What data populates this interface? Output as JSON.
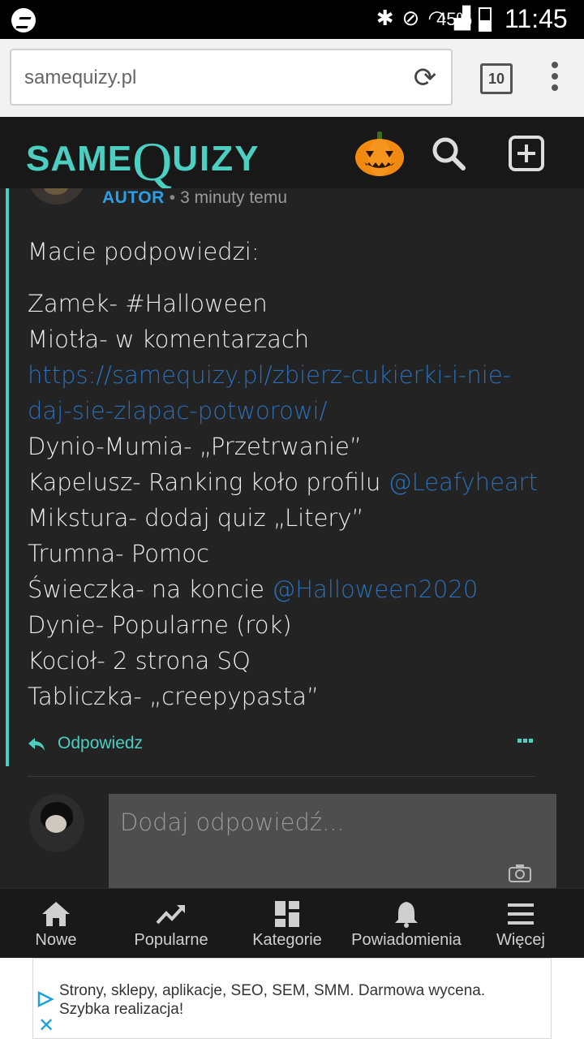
{
  "status_bar": {
    "battery": "45%",
    "time": "11:45"
  },
  "browser": {
    "url": "samequizy.pl",
    "tab_count": "10"
  },
  "site_header": {
    "logo_same": "SAME",
    "logo_q": "Q",
    "logo_uizy": "UIZY"
  },
  "comment": {
    "author_badge": "AUTOR",
    "separator": "•",
    "time": "3 minuty temu",
    "intro": "Macie podpowiedzi:",
    "lines": [
      {
        "text": "Zamek- #Halloween"
      },
      {
        "text": "Miotła- w komentarzach"
      },
      {
        "link": "https://samequizy.pl/zbierz-cukierki-i-nie-"
      },
      {
        "link": "daj-sie-zlapac-potworowi/"
      },
      {
        "text": "Dynio-Mumia- „Przetrwanie”"
      },
      {
        "text": "Kapelusz- Ranking koło profilu ",
        "mention": "@Leafyheart"
      },
      {
        "text": "Mikstura- dodaj quiz „Litery”"
      },
      {
        "text": "Trumna- Pomoc"
      },
      {
        "text": "Świeczka- na koncie ",
        "mention": "@Halloween2020"
      },
      {
        "text": "Dynie- Popularne (rok)"
      },
      {
        "text": "Kocioł- 2 strona SQ"
      },
      {
        "text": "Tabliczka- „creepypasta”"
      }
    ],
    "reply_label": "Odpowiedz"
  },
  "reply_box": {
    "placeholder": "Dodaj odpowiedź..."
  },
  "bottom_nav": {
    "items": [
      {
        "label": "Nowe",
        "icon": "home-icon"
      },
      {
        "label": "Popularne",
        "icon": "trending-icon"
      },
      {
        "label": "Kategorie",
        "icon": "grid-icon"
      },
      {
        "label": "Powiadomienia",
        "icon": "bell-icon"
      },
      {
        "label": "Więcej",
        "icon": "menu-icon"
      }
    ]
  },
  "ad": {
    "text": "Strony, sklepy, aplikacje, SEO, SEM, SMM. Darmowa wycena. Szybka realizacja!"
  },
  "colors": {
    "accent": "#4ccfc0",
    "link": "#2a6fb8",
    "author_badge": "#2d9fe6"
  }
}
